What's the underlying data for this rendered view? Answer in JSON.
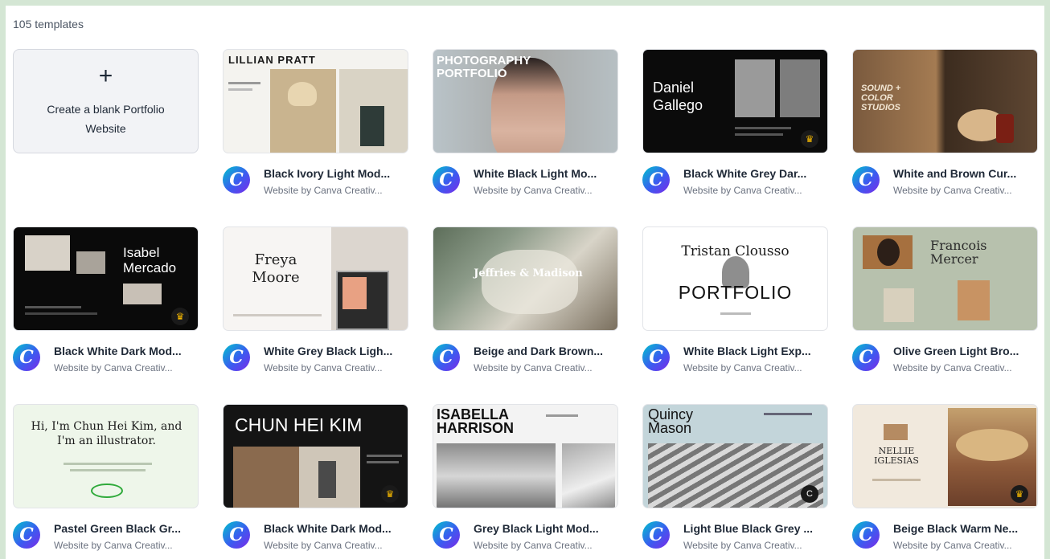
{
  "header": {
    "count_label": "105 templates"
  },
  "blank": {
    "plus": "+",
    "label": "Create a blank Portfolio Website"
  },
  "templates": [
    {
      "name": "Black Ivory Light Mod...",
      "by": "Website by Canva Creativ...",
      "thumb_text": "LILLIAN PRATT"
    },
    {
      "name": "White Black Light Mo...",
      "by": "Website by Canva Creativ...",
      "thumb_text": "PHOTOGRAPHY PORTFOLIO"
    },
    {
      "name": "Black White Grey Dar...",
      "by": "Website by Canva Creativ...",
      "thumb_text": "Daniel Gallego"
    },
    {
      "name": "White and Brown Cur...",
      "by": "Website by Canva Creativ...",
      "thumb_text": "SOUND + COLOR STUDIOS"
    },
    {
      "name": "Black White Dark Mod...",
      "by": "Website by Canva Creativ...",
      "thumb_text": "Isabel Mercado"
    },
    {
      "name": "White Grey Black Ligh...",
      "by": "Website by Canva Creativ...",
      "thumb_text": "Freya Moore"
    },
    {
      "name": "Beige and Dark Brown...",
      "by": "Website by Canva Creativ...",
      "thumb_text": "Jeffries & Madison"
    },
    {
      "name": "White Black Light Exp...",
      "by": "Website by Canva Creativ...",
      "thumb_text": "Tristan Clousso",
      "thumb_text2": "PORTFOLIO"
    },
    {
      "name": "Olive Green Light Bro...",
      "by": "Website by Canva Creativ...",
      "thumb_text": "Francois Mercer"
    },
    {
      "name": "Pastel Green Black Gr...",
      "by": "Website by Canva Creativ...",
      "thumb_text": "Hi, I'm Chun Hei Kim, and I'm an illustrator."
    },
    {
      "name": "Black White Dark Mod...",
      "by": "Website by Canva Creativ...",
      "thumb_text": "CHUN HEI KIM"
    },
    {
      "name": "Grey Black Light Mod...",
      "by": "Website by Canva Creativ...",
      "thumb_text": "ISABELLA HARRISON"
    },
    {
      "name": "Light Blue Black Grey ...",
      "by": "Website by Canva Creativ...",
      "thumb_text": "Quincy Mason"
    },
    {
      "name": "Beige Black Warm Ne...",
      "by": "Website by Canva Creativ...",
      "thumb_text": "NELLIE IGLESIAS"
    }
  ],
  "icons": {
    "logo": "canva-logo-icon",
    "crown": "crown-icon",
    "plus": "plus-icon"
  },
  "colors": {
    "frame": "#d4e6d4",
    "logo_start": "#00c4cc",
    "logo_end": "#7d2ae8",
    "crown": "#f5b800"
  }
}
